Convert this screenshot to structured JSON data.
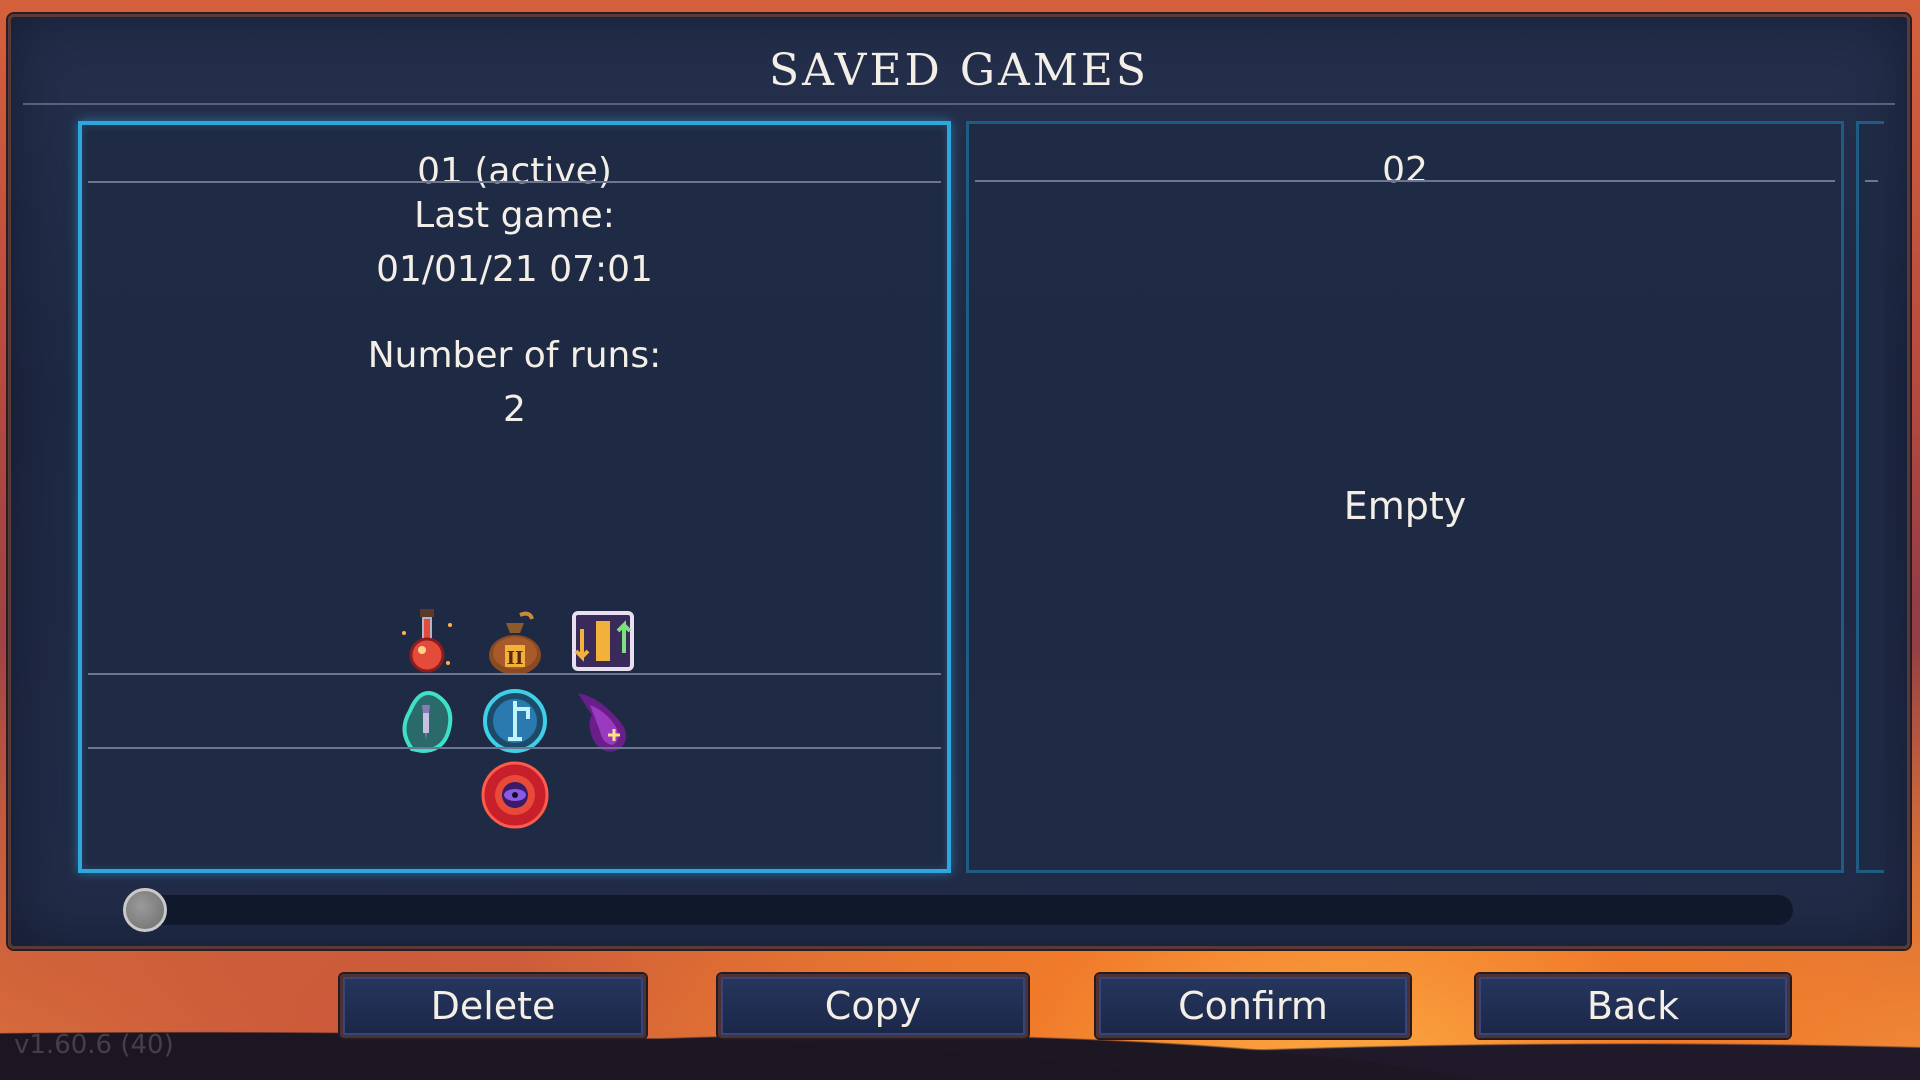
{
  "title": "SAVED GAMES",
  "slots": [
    {
      "header": "01 (active)",
      "last_game_label": "Last game:",
      "last_game_value": "01/01/21 07:01",
      "runs_label": "Number of runs:",
      "runs_value": "2",
      "icons": [
        [
          "potion-icon",
          "gold-bag-icon",
          "swap-upgrade-icon"
        ],
        [
          "rune-crystal-icon",
          "teleport-rune-icon",
          "purple-flame-icon"
        ],
        [
          "red-eye-orb-icon"
        ]
      ]
    },
    {
      "header": "02",
      "status": "Empty"
    }
  ],
  "scroll": {
    "position": 0
  },
  "buttons": {
    "delete": "Delete",
    "copy": "Copy",
    "confirm": "Confirm",
    "back": "Back"
  },
  "version": "v1.60.6 (40)",
  "colors": {
    "active_border": "#2ea7dc",
    "inactive_border": "#1e5c84",
    "panel_bg": "#222c48",
    "button_bg": "#1f2c50"
  }
}
